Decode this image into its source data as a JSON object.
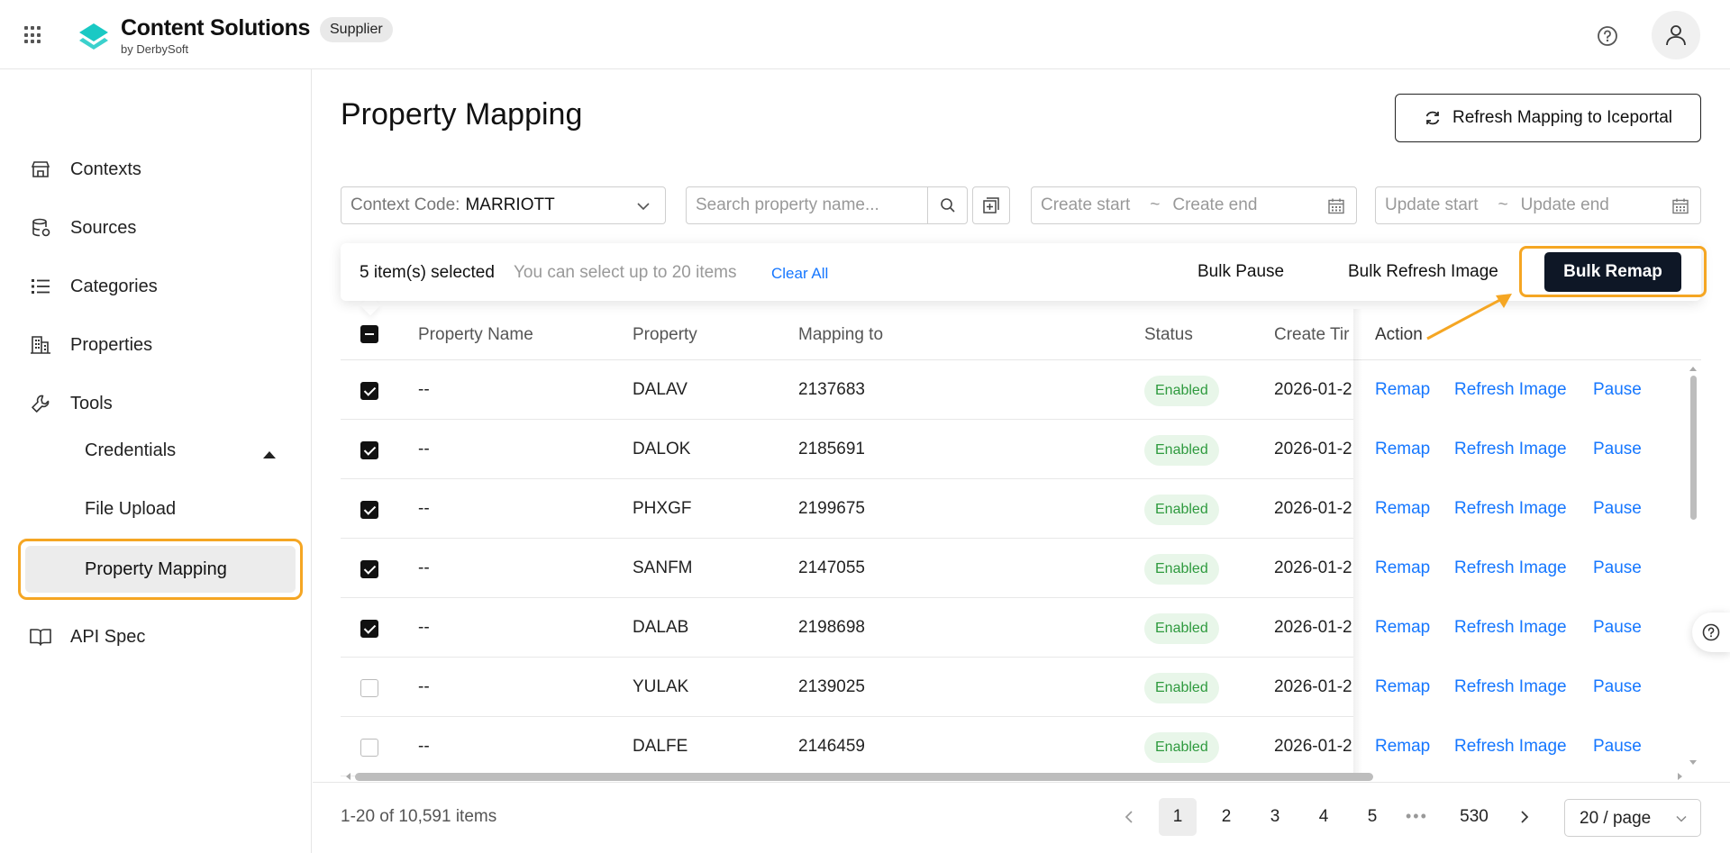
{
  "header": {
    "brand_title": "Content Solutions",
    "brand_sub": "by DerbySoft",
    "badge": "Supplier",
    "help_icon": "help-circle-icon",
    "avatar_icon": "user-icon"
  },
  "sidebar": {
    "items": [
      {
        "label": "Contexts",
        "icon": "store-icon"
      },
      {
        "label": "Sources",
        "icon": "database-icon"
      },
      {
        "label": "Categories",
        "icon": "list-icon"
      },
      {
        "label": "Properties",
        "icon": "building-icon"
      },
      {
        "label": "Tools",
        "icon": "wrench-icon"
      },
      {
        "label": "API Spec",
        "icon": "book-icon"
      }
    ],
    "tools_children": [
      "Credentials",
      "File Upload",
      "Property Mapping"
    ],
    "active": "Property Mapping"
  },
  "main": {
    "title": "Property Mapping",
    "refresh_button": "Refresh Mapping to Iceportal",
    "filters": {
      "context_label": "Context Code:",
      "context_value": "MARRIOTT",
      "search_placeholder": "Search property name...",
      "create_start": "Create start",
      "create_end": "Create end",
      "update_start": "Update start",
      "update_end": "Update end",
      "separator": "~"
    },
    "selection": {
      "count_text": "5 item(s) selected",
      "hint": "You can select up to 20 items",
      "clear_all": "Clear All",
      "bulk_pause": "Bulk Pause",
      "bulk_refresh_image": "Bulk Refresh Image",
      "bulk_remap": "Bulk Remap"
    },
    "table": {
      "columns": [
        "Property Name",
        "Property",
        "Mapping to",
        "Status",
        "Create Tir",
        "Action"
      ],
      "actions": [
        "Remap",
        "Refresh Image",
        "Pause"
      ],
      "rows": [
        {
          "checked": true,
          "name": "--",
          "property": "DALAV",
          "mapping": "2137683",
          "status": "Enabled",
          "created": "2026-01-2"
        },
        {
          "checked": true,
          "name": "--",
          "property": "DALOK",
          "mapping": "2185691",
          "status": "Enabled",
          "created": "2026-01-2"
        },
        {
          "checked": true,
          "name": "--",
          "property": "PHXGF",
          "mapping": "2199675",
          "status": "Enabled",
          "created": "2026-01-2"
        },
        {
          "checked": true,
          "name": "--",
          "property": "SANFM",
          "mapping": "2147055",
          "status": "Enabled",
          "created": "2026-01-2"
        },
        {
          "checked": true,
          "name": "--",
          "property": "DALAB",
          "mapping": "2198698",
          "status": "Enabled",
          "created": "2026-01-2"
        },
        {
          "checked": false,
          "name": "--",
          "property": "YULAK",
          "mapping": "2139025",
          "status": "Enabled",
          "created": "2026-01-2"
        },
        {
          "checked": false,
          "name": "--",
          "property": "DALFE",
          "mapping": "2146459",
          "status": "Enabled",
          "created": "2026-01-2"
        }
      ]
    },
    "pagination": {
      "total_text": "1-20 of 10,591 items",
      "pages": [
        "1",
        "2",
        "3",
        "4",
        "5"
      ],
      "ellipsis": "•••",
      "last_page": "530",
      "current": "1",
      "page_size": "20 / page"
    }
  },
  "colors": {
    "accent_highlight": "#f5a623",
    "link": "#1677ff",
    "primary_button": "#0e1726",
    "status_green": "#2e9a3e",
    "logo_cyan": "#19c9c4"
  }
}
